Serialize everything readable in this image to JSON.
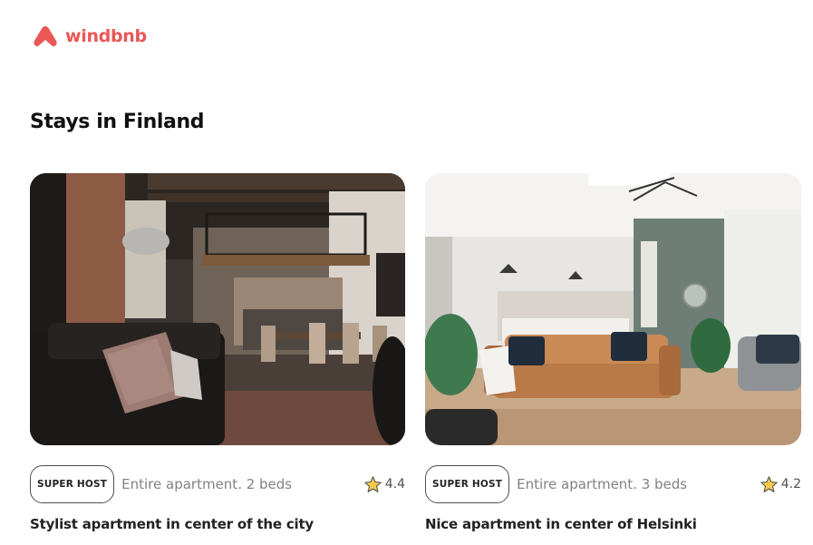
{
  "brand": {
    "name": "windbnb",
    "color": "#EB5757"
  },
  "page": {
    "title": "Stays in Finland"
  },
  "stays": [
    {
      "badge": "SUPER HOST",
      "type": "Entire apartment. 2 beds",
      "rating": "4.4",
      "title": "Stylist apartment in center of the city",
      "image": "industrial-loft-living-room"
    },
    {
      "badge": "SUPER HOST",
      "type": "Entire apartment. 3 beds",
      "rating": "4.2",
      "title": "Nice apartment in center of Helsinki",
      "image": "bright-living-room-leather-sofa"
    }
  ],
  "icons": {
    "logo": "windbnb-logo-icon",
    "star": "star-icon",
    "star_color": "#F2C94C"
  }
}
